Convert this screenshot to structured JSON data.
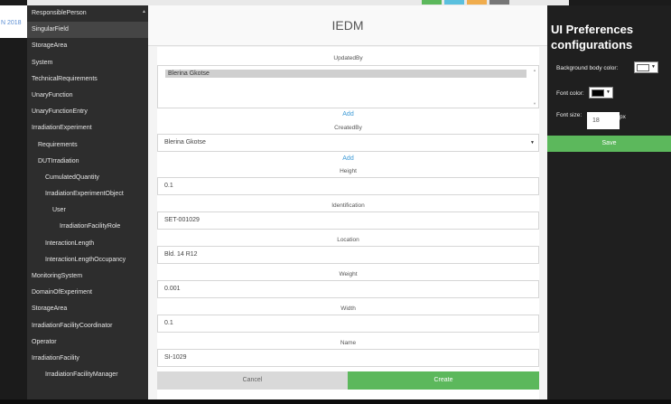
{
  "background": {
    "date_text": "N 2018"
  },
  "sidebar": {
    "items": [
      {
        "label": "ResponsiblePerson",
        "level": 0
      },
      {
        "label": "SingularField",
        "level": 0,
        "active": true
      },
      {
        "label": "StorageArea",
        "level": 0
      },
      {
        "label": "System",
        "level": 0
      },
      {
        "label": "TechnicalRequirements",
        "level": 0
      },
      {
        "label": "UnaryFunction",
        "level": 0
      },
      {
        "label": "UnaryFunctionEntry",
        "level": 0
      },
      {
        "label": "IrradiationExperiment",
        "level": 0
      },
      {
        "label": "Requirements",
        "level": 1
      },
      {
        "label": "DUTIrradiation",
        "level": 1
      },
      {
        "label": "CumulatedQuantity",
        "level": 2
      },
      {
        "label": "IrradiationExperimentObject",
        "level": 2
      },
      {
        "label": "User",
        "level": 3
      },
      {
        "label": "IrradiationFacilityRole",
        "level": 4
      },
      {
        "label": "InteractionLength",
        "level": 2
      },
      {
        "label": "InteractionLengthOccupancy",
        "level": 2
      },
      {
        "label": "MonitoringSystem",
        "level": 0
      },
      {
        "label": "DomainOfExperiment",
        "level": 0
      },
      {
        "label": "StorageArea",
        "level": 0
      },
      {
        "label": "IrradiationFacilityCoordinator",
        "level": 0
      },
      {
        "label": "Operator",
        "level": 0
      },
      {
        "label": "IrradiationFacility",
        "level": 0
      },
      {
        "label": "IrradiationFacilityManager",
        "level": 2
      }
    ]
  },
  "modal": {
    "title": "IEDM",
    "updated_by": {
      "label": "UpdatedBy",
      "selected_option": "Blerina Gkotse",
      "add_label": "Add"
    },
    "created_by": {
      "label": "CreatedBy",
      "value": "Blerina Gkotse",
      "add_label": "Add"
    },
    "fields": {
      "height": {
        "label": "Height",
        "value": "0.1"
      },
      "identification": {
        "label": "Identification",
        "value": "SET-001029"
      },
      "location": {
        "label": "Location",
        "value": "Bld. 14 R12"
      },
      "weight": {
        "label": "Weight",
        "value": "0.001"
      },
      "width": {
        "label": "Width",
        "value": "0.1"
      },
      "name": {
        "label": "Name",
        "value": "SI-1029"
      }
    },
    "cancel_label": "Cancel",
    "create_label": "Create"
  },
  "prefs": {
    "title": "UI Preferences configurations",
    "bg_color_label": "Background body color:",
    "bg_color_value": "#ffffff",
    "font_color_label": "Font color:",
    "font_color_value": "#000000",
    "font_size_label": "Font size:",
    "font_size_value": "18",
    "font_size_unit": "px",
    "save_label": "Save"
  },
  "colors": {
    "accent_green": "#5cb85c",
    "link_blue": "#3d9ad6",
    "sidebar_bg": "#2d2d2d"
  }
}
